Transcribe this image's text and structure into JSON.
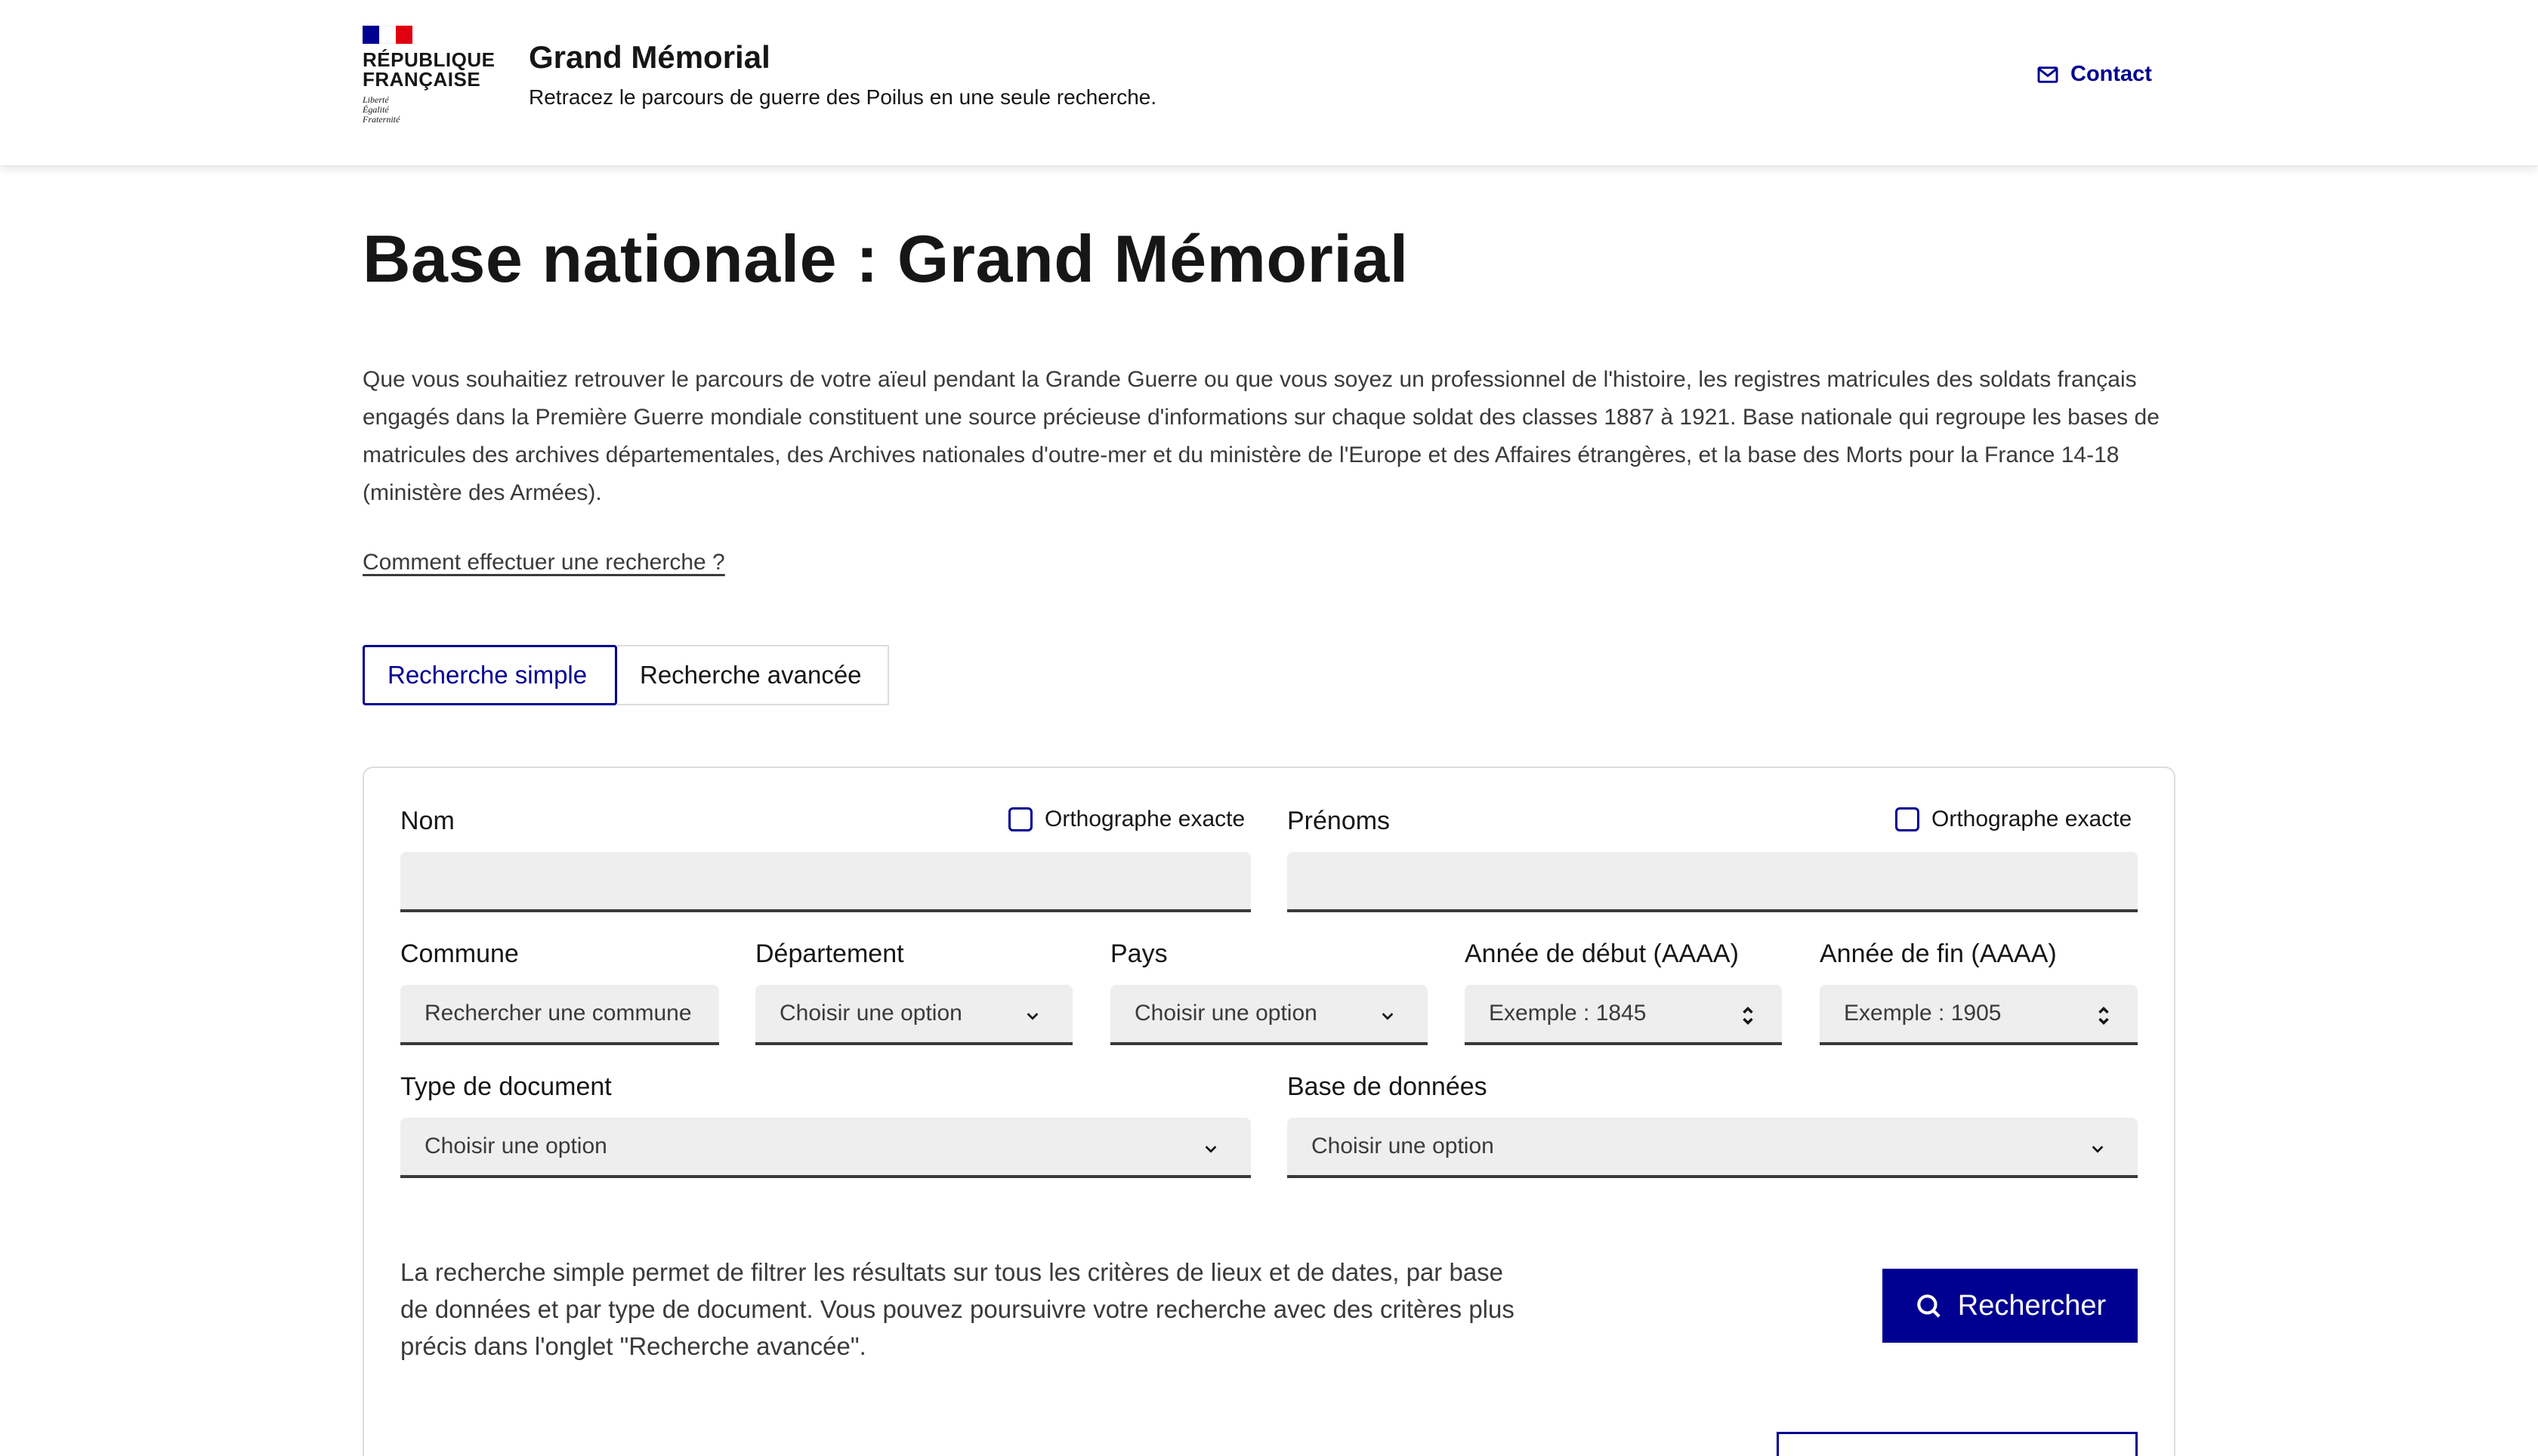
{
  "header": {
    "logo_text": "RÉPUBLIQUE FRANÇAISE",
    "logo_line1": "RÉPUBLIQUE",
    "logo_line2": "FRANÇAISE",
    "devise": [
      "Liberté",
      "Égalité",
      "Fraternité"
    ],
    "site_title": "Grand Mémorial",
    "tagline": "Retracez le parcours de guerre des Poilus en une seule recherche.",
    "contact_label": "Contact",
    "contact_icon": "mail-icon"
  },
  "main": {
    "title": "Base nationale : Grand Mémorial",
    "intro": "Que vous souhaitiez retrouver le parcours de votre aïeul pendant la Grande Guerre ou que vous soyez un professionnel de l'histoire, les registres matricules des soldats français engagés dans la Première Guerre mondiale constituent une source précieuse d'informations sur chaque soldat des classes 1887 à 1921. Base nationale qui regroupe les bases de matricules des archives départementales, des Archives nationales d'outre-mer et du ministère de l'Europe et des Affaires étrangères, et la base des Morts pour la France 14-18 (ministère des Armées).",
    "howto_link": "Comment effectuer une recherche ?",
    "tabs": [
      {
        "label": "Recherche simple",
        "active": true
      },
      {
        "label": "Recherche avancée",
        "active": false
      }
    ]
  },
  "form": {
    "nom": {
      "label": "Nom",
      "value": "",
      "exact_label": "Orthographe exacte",
      "exact_checked": false
    },
    "prenoms": {
      "label": "Prénoms",
      "value": "",
      "exact_label": "Orthographe exacte",
      "exact_checked": false
    },
    "commune": {
      "label": "Commune",
      "placeholder": "Rechercher une commune"
    },
    "departement": {
      "label": "Département",
      "selected": "Choisir une option"
    },
    "pays": {
      "label": "Pays",
      "selected": "Choisir une option"
    },
    "annee_debut": {
      "label": "Année de début (AAAA)",
      "placeholder": "Exemple : 1845"
    },
    "annee_fin": {
      "label": "Année de fin (AAAA)",
      "placeholder": "Exemple : 1905"
    },
    "type_document": {
      "label": "Type de document",
      "selected": "Choisir une option"
    },
    "base_donnees": {
      "label": "Base de données",
      "selected": "Choisir une option"
    },
    "help_text": "La recherche simple permet de filtrer les résultats sur tous les critères de lieux et de dates, par base de données et par type de document. Vous pouvez poursuivre votre recherche avec des critères plus précis dans l'onglet \"Recherche avancée\".",
    "search_button": "Rechercher",
    "search_icon": "search-icon"
  },
  "colors": {
    "accent": "#000091",
    "flag_red": "#e1000f",
    "field_bg": "#eeeeee",
    "text": "#161616"
  }
}
